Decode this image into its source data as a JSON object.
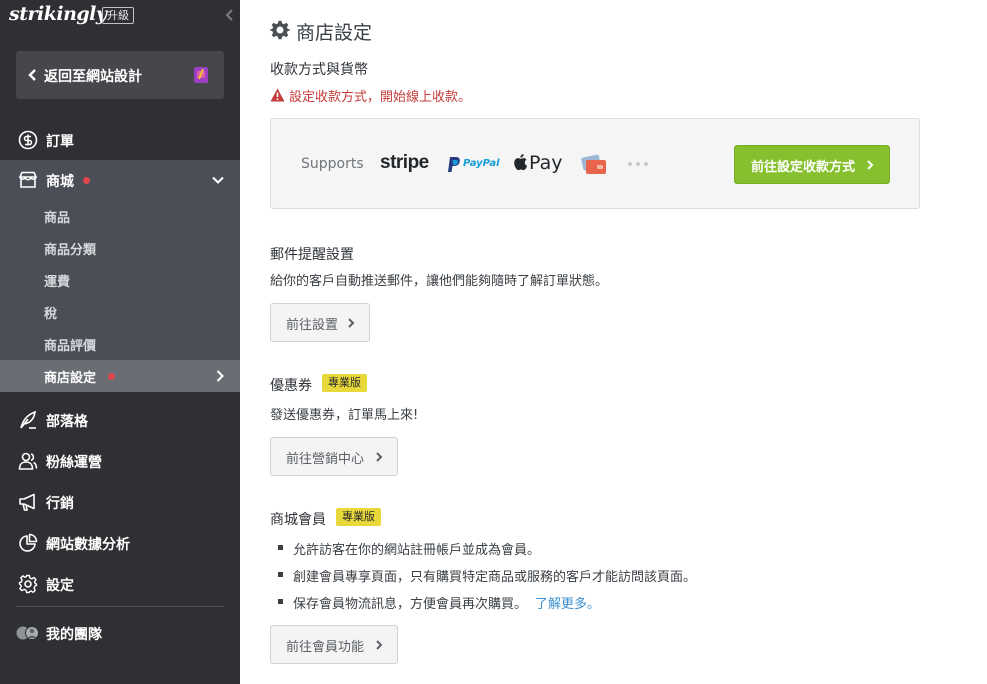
{
  "sidebar": {
    "logo": "strikingly",
    "upgrade_label": "升級",
    "back_label": "返回至網站設計",
    "nav": {
      "orders": "訂單",
      "store": "商城",
      "blog": "部落格",
      "fans": "粉絲運營",
      "marketing": "行銷",
      "analytics": "網站數據分析",
      "settings": "設定",
      "team": "我的團隊"
    },
    "store_sub": {
      "products": "商品",
      "categories": "商品分類",
      "shipping": "運費",
      "tax": "稅",
      "reviews": "商品評價",
      "store_settings": "商店設定"
    }
  },
  "main": {
    "title": "商店設定",
    "payment": {
      "heading": "收款方式與貨幣",
      "warning": "設定收款方式，開始線上收款。",
      "supports": "Supports",
      "stripe": "stripe",
      "paypal": "PayPal",
      "applepay": "Pay",
      "button": "前往設定收款方式"
    },
    "email": {
      "heading": "郵件提醒設置",
      "desc": "給你的客戶自動推送郵件，讓他們能夠隨時了解訂單狀態。",
      "button": "前往設置"
    },
    "coupon": {
      "heading": "優惠券",
      "badge": "專業版",
      "desc": "發送優惠券，訂單馬上來!",
      "button": "前往營銷中心"
    },
    "membership": {
      "heading": "商城會員",
      "badge": "專業版",
      "bullets": [
        "允許訪客在你的網站註冊帳戶並成為會員。",
        "創建會員專享頁面，只有購買特定商品或服務的客戶才能訪問該頁面。",
        "保存會員物流訊息，方便會員再次購買。"
      ],
      "learn_more": "了解更多。",
      "button": "前往會員功能"
    }
  },
  "colors": {
    "sidebar_bg": "#2f3033",
    "store_group_bg": "#4b4e56",
    "active_bg": "#6a6d74",
    "accent_green": "#86c02e",
    "warning_red": "#c53b3b",
    "pro_yellow": "#e8d83a",
    "link_blue": "#3b8fd1"
  },
  "icons": {
    "orders": "dollar-circle-icon",
    "store": "storefront-icon",
    "blog": "quill-icon",
    "fans": "users-icon",
    "marketing": "megaphone-icon",
    "analytics": "pie-chart-icon",
    "settings": "gear-icon",
    "team": "team-avatars-icon"
  }
}
